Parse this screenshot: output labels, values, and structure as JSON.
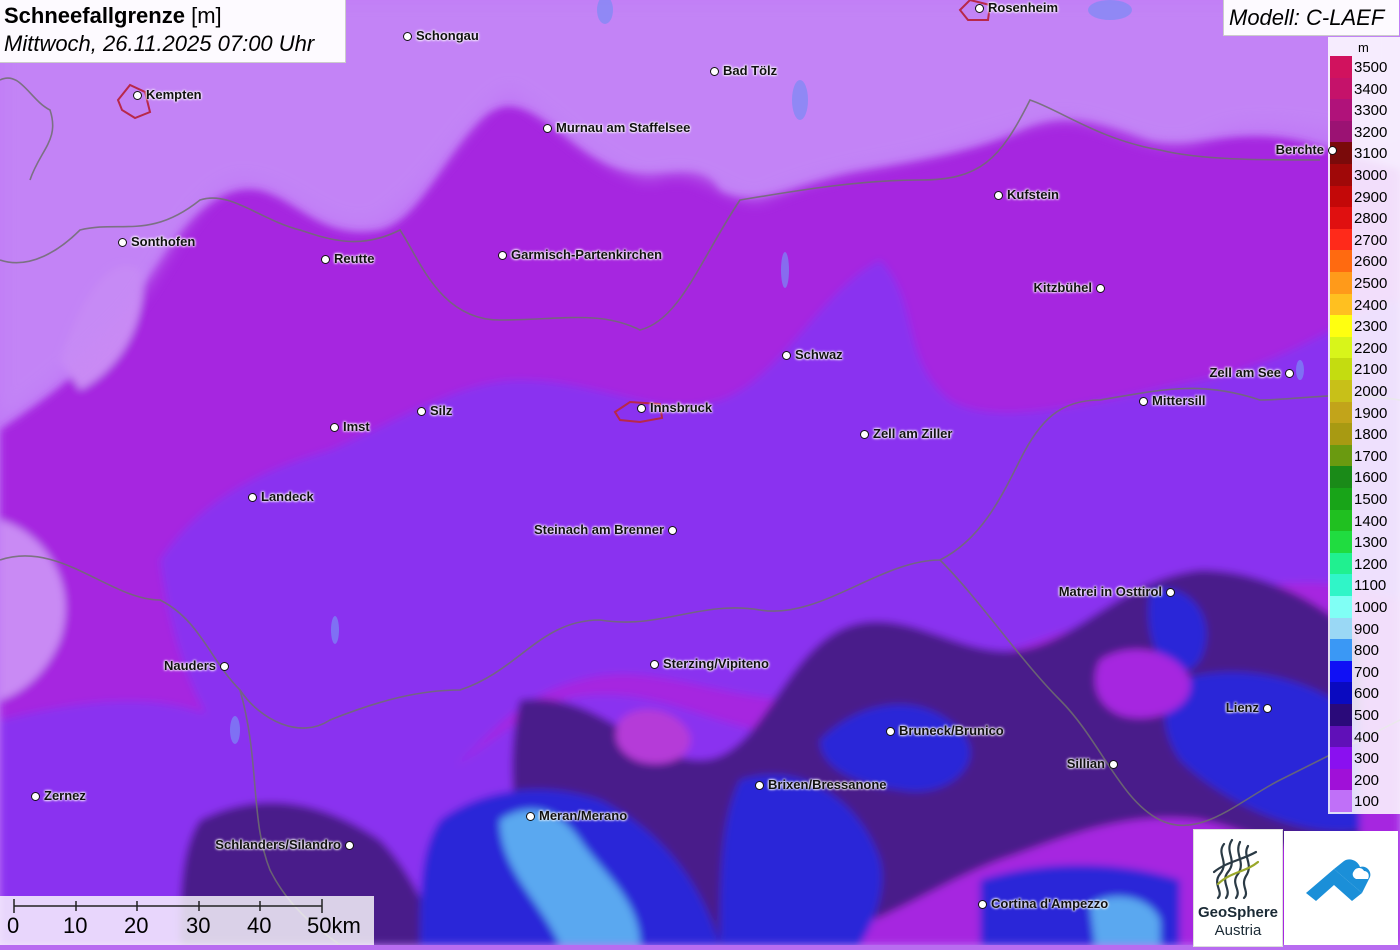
{
  "title": {
    "parameter": "Schneefallgrenze",
    "unit": "[m]",
    "datetime": "Mittwoch, 26.11.2025 07:00 Uhr"
  },
  "model_label": "Modell: C-LAEF",
  "legend": {
    "unit": "m",
    "classes": [
      {
        "label": "3500",
        "color": "#d1125e"
      },
      {
        "label": "3400",
        "color": "#c5126a"
      },
      {
        "label": "3300",
        "color": "#b0127a"
      },
      {
        "label": "3200",
        "color": "#9b1273"
      },
      {
        "label": "3100",
        "color": "#7a0a0a"
      },
      {
        "label": "3000",
        "color": "#a00808"
      },
      {
        "label": "2900",
        "color": "#c30808"
      },
      {
        "label": "2800",
        "color": "#e01010"
      },
      {
        "label": "2700",
        "color": "#ff2a1a"
      },
      {
        "label": "2600",
        "color": "#ff6a10"
      },
      {
        "label": "2500",
        "color": "#ff9a1a"
      },
      {
        "label": "2400",
        "color": "#ffc020"
      },
      {
        "label": "2300",
        "color": "#ffff10"
      },
      {
        "label": "2200",
        "color": "#d8f51a"
      },
      {
        "label": "2100",
        "color": "#c4dc10"
      },
      {
        "label": "2000",
        "color": "#c8c018"
      },
      {
        "label": "1900",
        "color": "#c2a41a"
      },
      {
        "label": "1800",
        "color": "#a89a12"
      },
      {
        "label": "1700",
        "color": "#6a9a10"
      },
      {
        "label": "1600",
        "color": "#1a8a18"
      },
      {
        "label": "1500",
        "color": "#18a418"
      },
      {
        "label": "1400",
        "color": "#20c020"
      },
      {
        "label": "1300",
        "color": "#20dc40"
      },
      {
        "label": "1200",
        "color": "#20f090"
      },
      {
        "label": "1100",
        "color": "#30f5c8"
      },
      {
        "label": "1000",
        "color": "#80fff5"
      },
      {
        "label": "900",
        "color": "#9ad8f5"
      },
      {
        "label": "800",
        "color": "#3a98f5"
      },
      {
        "label": "700",
        "color": "#1010f5"
      },
      {
        "label": "600",
        "color": "#0a0ac0"
      },
      {
        "label": "500",
        "color": "#2a0a7a"
      },
      {
        "label": "400",
        "color": "#6010b8"
      },
      {
        "label": "300",
        "color": "#8a10f0"
      },
      {
        "label": "200",
        "color": "#a010d8"
      },
      {
        "label": "100",
        "color": "#c070f8"
      }
    ]
  },
  "cities": [
    {
      "name": "Rosenheim"
    },
    {
      "name": "Schongau"
    },
    {
      "name": "Bad Tölz"
    },
    {
      "name": "Kempten"
    },
    {
      "name": "Murnau am Staffelsee"
    },
    {
      "name": "Berchte"
    },
    {
      "name": "Kufstein"
    },
    {
      "name": "Sonthofen"
    },
    {
      "name": "Reutte"
    },
    {
      "name": "Garmisch-Partenkirchen"
    },
    {
      "name": "Kitzbühel"
    },
    {
      "name": "Schwaz"
    },
    {
      "name": "Zell am See"
    },
    {
      "name": "Silz"
    },
    {
      "name": "Innsbruck"
    },
    {
      "name": "Mittersill"
    },
    {
      "name": "Imst"
    },
    {
      "name": "Zell am Ziller"
    },
    {
      "name": "Landeck"
    },
    {
      "name": "Steinach am Brenner"
    },
    {
      "name": "Matrei in Osttirol"
    },
    {
      "name": "Nauders"
    },
    {
      "name": "Sterzing/Vipiteno"
    },
    {
      "name": "Lienz"
    },
    {
      "name": "Bruneck/Brunico"
    },
    {
      "name": "Sillian"
    },
    {
      "name": "Brixen/Bressanone"
    },
    {
      "name": "Zernez"
    },
    {
      "name": "Meran/Merano"
    },
    {
      "name": "Schlanders/Silandro"
    },
    {
      "name": "Cortina d'Ampezzo"
    }
  ],
  "scale_bar": {
    "ticks": [
      "0",
      "10",
      "20",
      "30",
      "40",
      "50km"
    ]
  },
  "logos": {
    "geosphere_line1": "GeoSphere",
    "geosphere_line2": "Austria"
  }
}
